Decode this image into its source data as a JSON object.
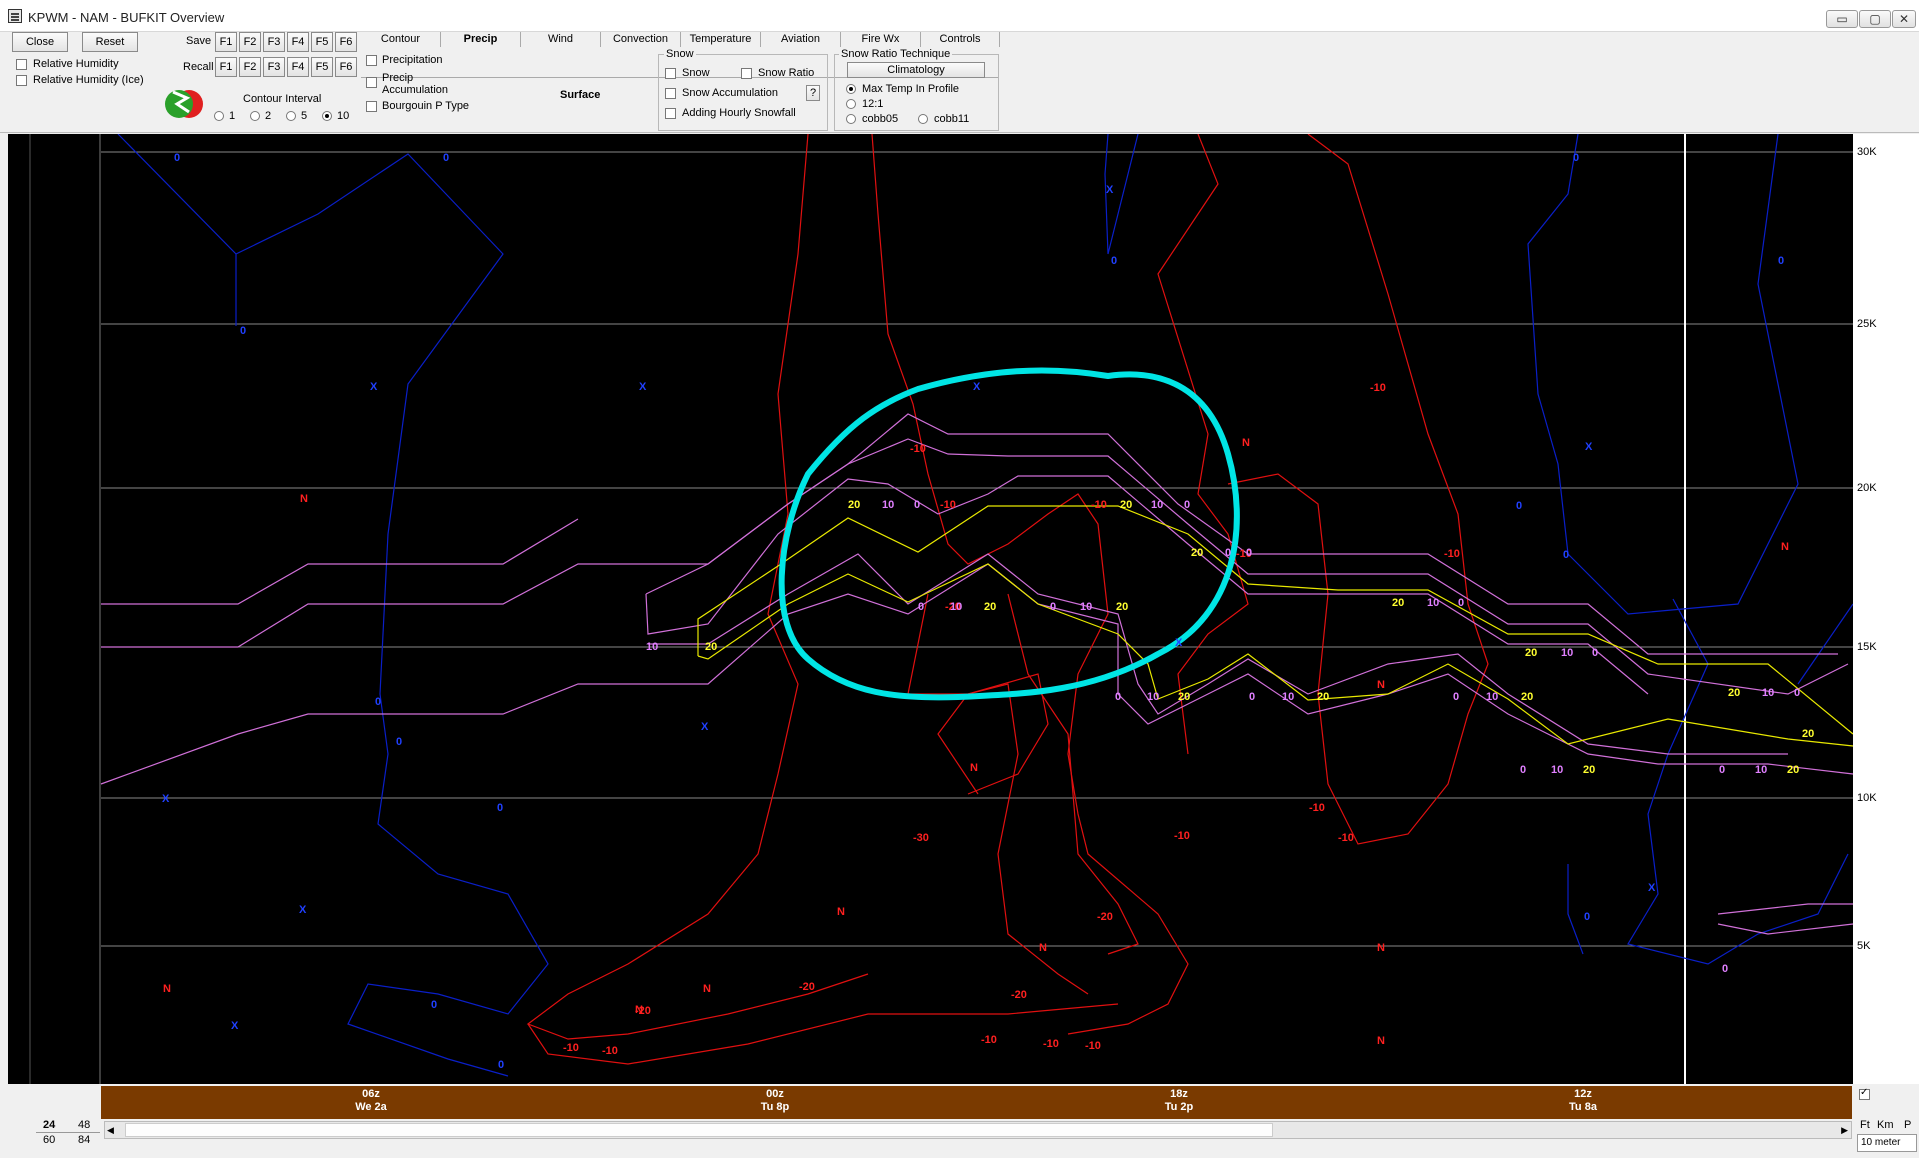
{
  "window": {
    "title": "KPWM - NAM - BUFKIT Overview",
    "min_symbol": "▭",
    "max_symbol": "▢",
    "close_symbol": "✕"
  },
  "toolbar": {
    "close_label": "Close",
    "reset_label": "Reset",
    "save_label": "Save",
    "recall_label": "Recall",
    "fkeys": [
      "F1",
      "F2",
      "F3",
      "F4",
      "F5",
      "F6"
    ],
    "relative_humidity": "Relative Humidity",
    "relative_humidity_ice": "Relative Humidity (Ice)",
    "contour_interval_label": "Contour Interval",
    "contour_options": [
      "1",
      "2",
      "5",
      "10"
    ],
    "contour_selected": "10"
  },
  "tabs": [
    "Contour",
    "Precip",
    "Wind",
    "Convection",
    "Temperature",
    "Aviation",
    "Fire Wx",
    "Controls"
  ],
  "active_tab": "Precip",
  "precip_panel": {
    "precipitation": "Precipitation",
    "precip_accumulation_1": "Precip",
    "precip_accumulation_2": "Accumulation",
    "bourgouin": "Bourgouin P Type",
    "surface": "Surface",
    "snow_group": "Snow",
    "snow": "Snow",
    "snow_ratio": "Snow Ratio",
    "snow_accumulation": "Snow Accumulation",
    "help": "?",
    "adding_hourly": "Adding Hourly Snowfall",
    "technique_group": "Snow Ratio Technique",
    "climatology": "Climatology",
    "max_temp": "Max Temp In Profile",
    "ratio_12": "12:1",
    "cobb05": "cobb05",
    "cobb11": "cobb11"
  },
  "yaxis_labels": [
    "30K",
    "25K",
    "20K",
    "15K",
    "10K",
    "5K"
  ],
  "time_labels": [
    {
      "top": "06z",
      "bottom": "We 2a"
    },
    {
      "top": "00z",
      "bottom": "Tu 8p"
    },
    {
      "top": "18z",
      "bottom": "Tu 2p"
    },
    {
      "top": "12z",
      "bottom": "Tu 8a"
    }
  ],
  "bottom": {
    "h24": "24",
    "h48": "48",
    "h60": "60",
    "h84": "84",
    "unit_ft": "Ft",
    "unit_km": "Km",
    "unit_p": "P",
    "level_select": "10 meter",
    "check_mark": "✓"
  },
  "colors": {
    "temperature_contour": "#ff0000",
    "omega_contour": "#0000dd",
    "dgz_contour": "#ffff00",
    "rh_contour": "#dd66dd",
    "annotation_circle": "#00e5e5",
    "time_axis": "#7a3a00"
  },
  "plot_annotations": {
    "zero": "0",
    "ten": "10",
    "twenty": "20",
    "neg10": "-10",
    "neg20": "-20",
    "neg30": "-30",
    "N": "N",
    "X": "X"
  }
}
